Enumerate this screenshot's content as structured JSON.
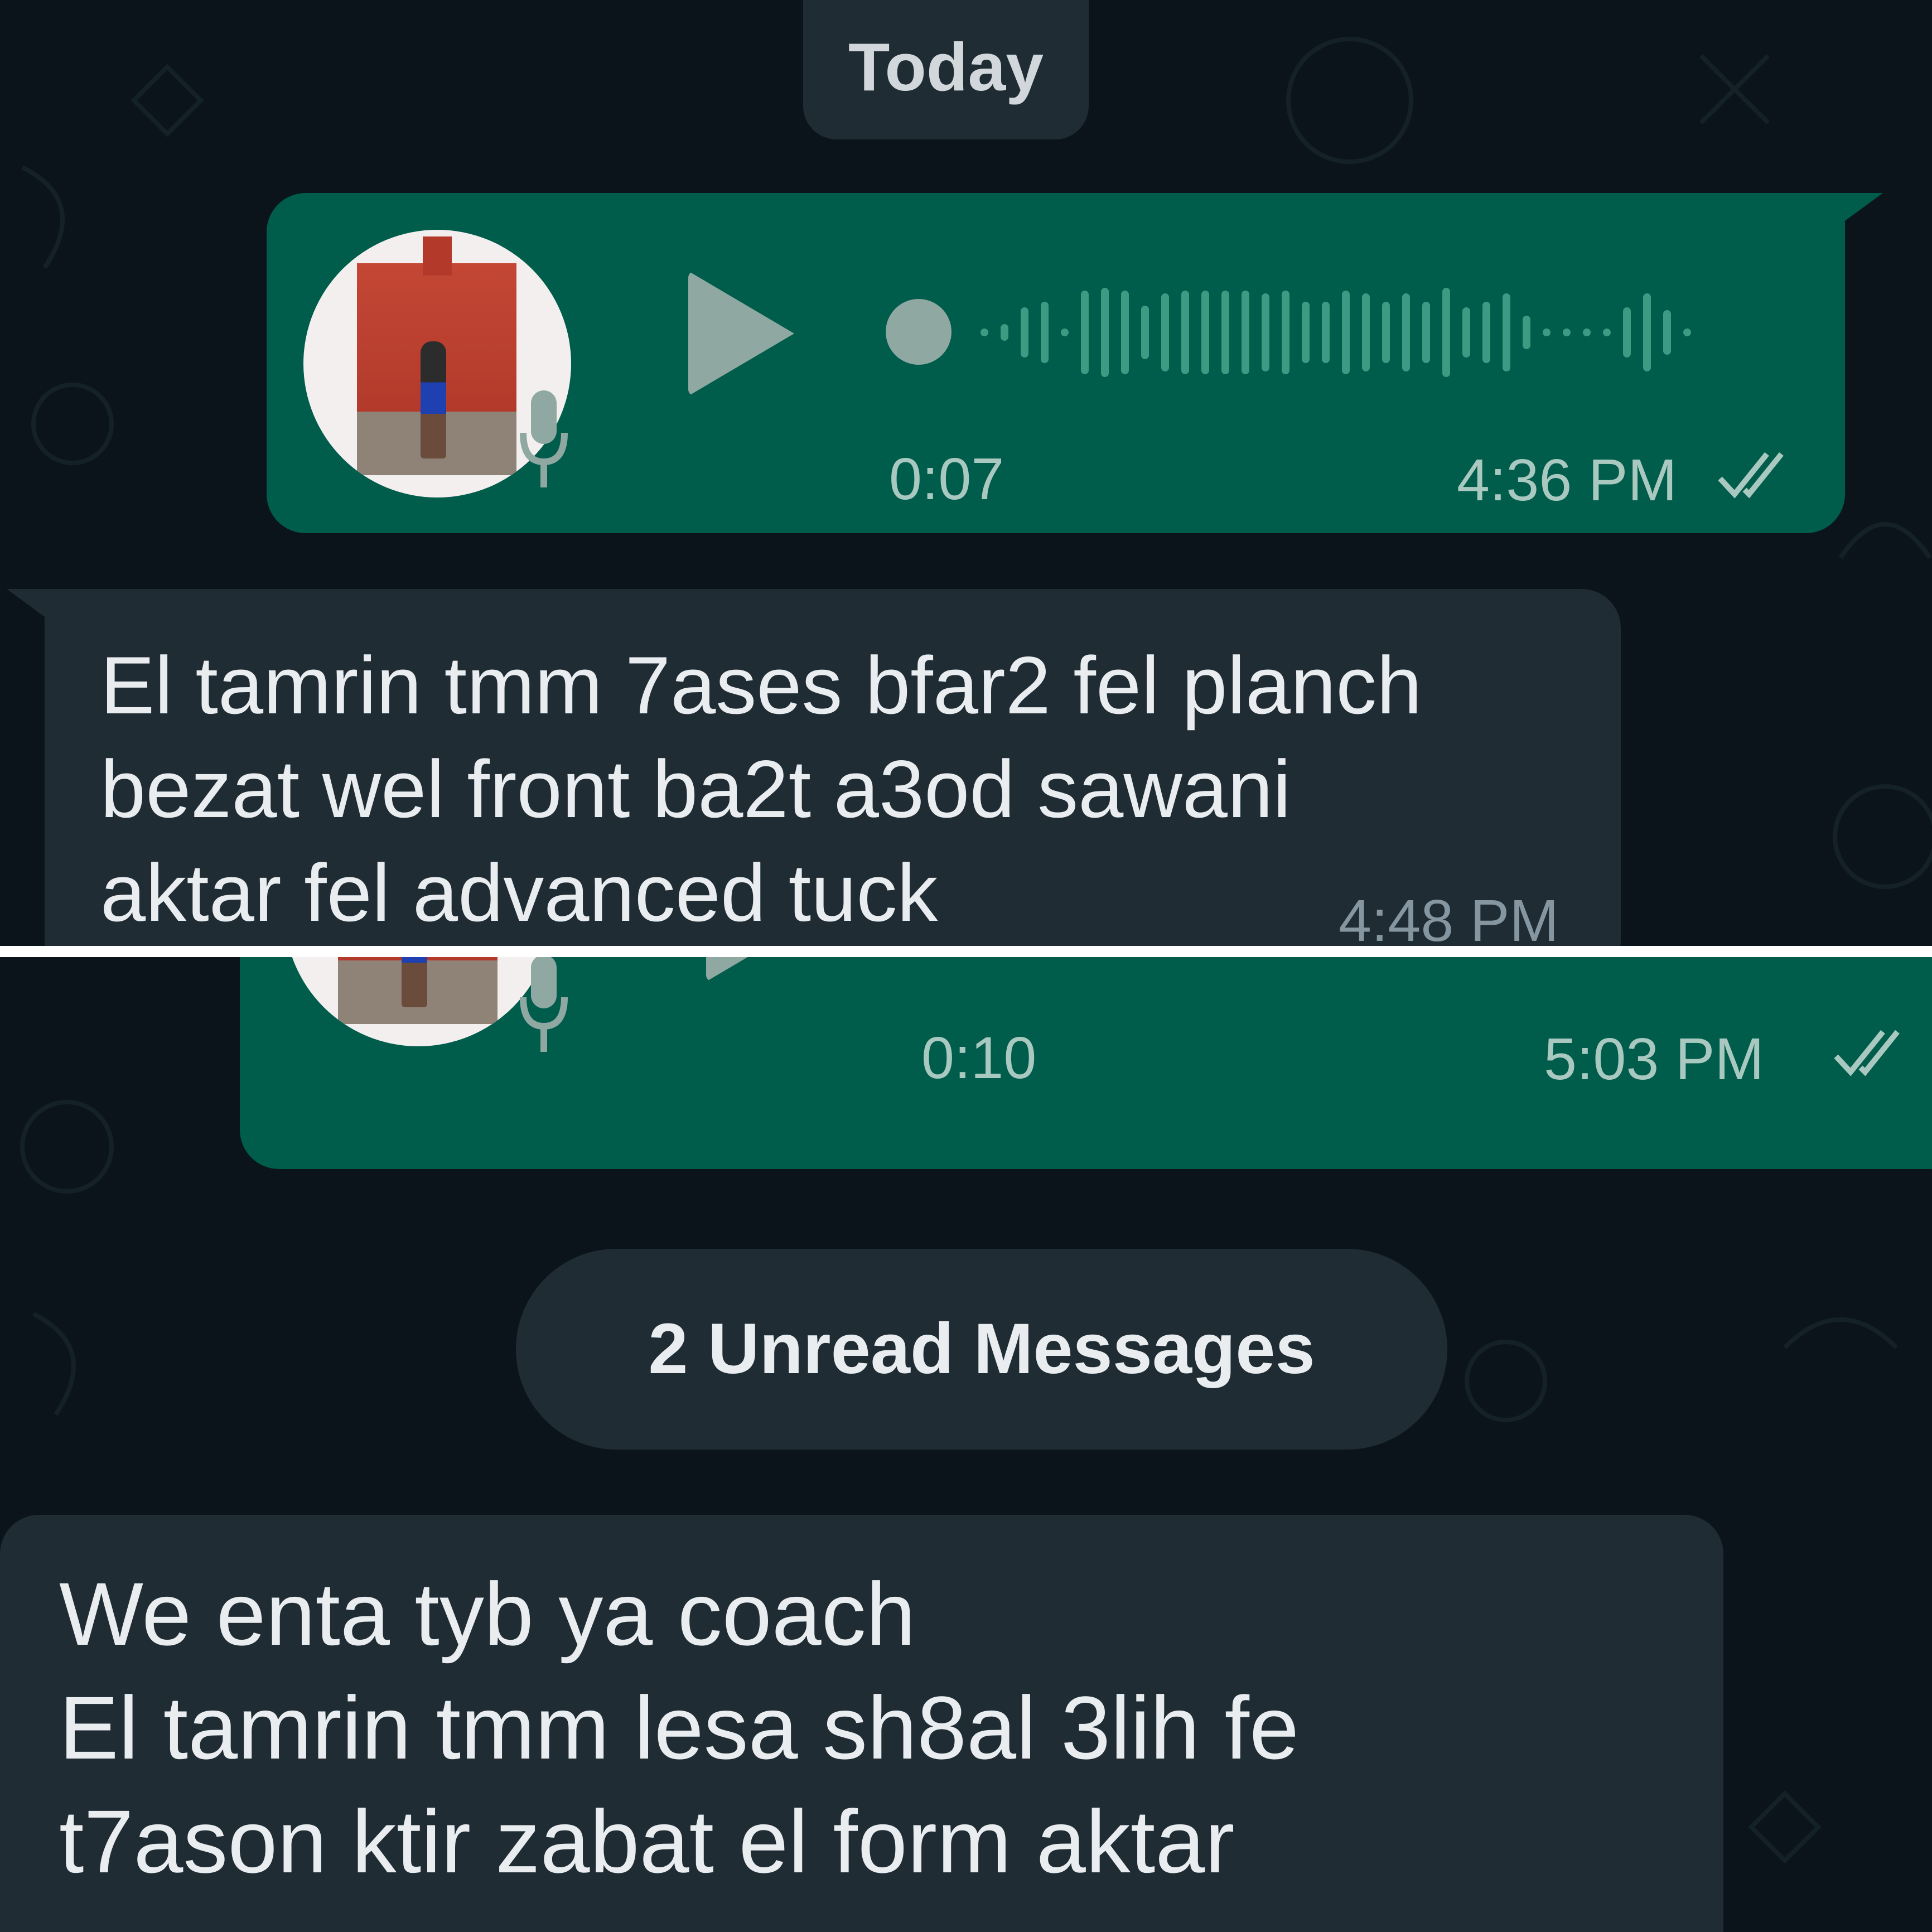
{
  "chat": {
    "date_label": "Today",
    "unread_label": "2 Unread Messages",
    "voice_note_1": {
      "duration": "0:07",
      "time": "4:36 PM",
      "status": "read",
      "icons": [
        "play-icon",
        "mic-icon",
        "double-check-icon"
      ]
    },
    "message_1": {
      "lines": [
        "El tamrin tmm 7ases bfar2 fel planch",
        "bezat wel front ba2t a3od sawani",
        "aktar fel advanced tuck"
      ],
      "time": "4:48 PM"
    },
    "voice_note_2": {
      "duration": "0:10",
      "time": "5:03 PM",
      "status": "read"
    },
    "message_2": {
      "lines": [
        "We enta tyb ya coach",
        "El tamrin tmm lesa sh8al 3lih fe",
        "t7ason ktir zabat el form aktar"
      ]
    }
  },
  "colors": {
    "background": "#0b141a",
    "outgoing_bubble": "#005c4b",
    "incoming_bubble": "#1f2c34",
    "waveform": "#3f9a83",
    "ticks": "#a9c9c0"
  }
}
